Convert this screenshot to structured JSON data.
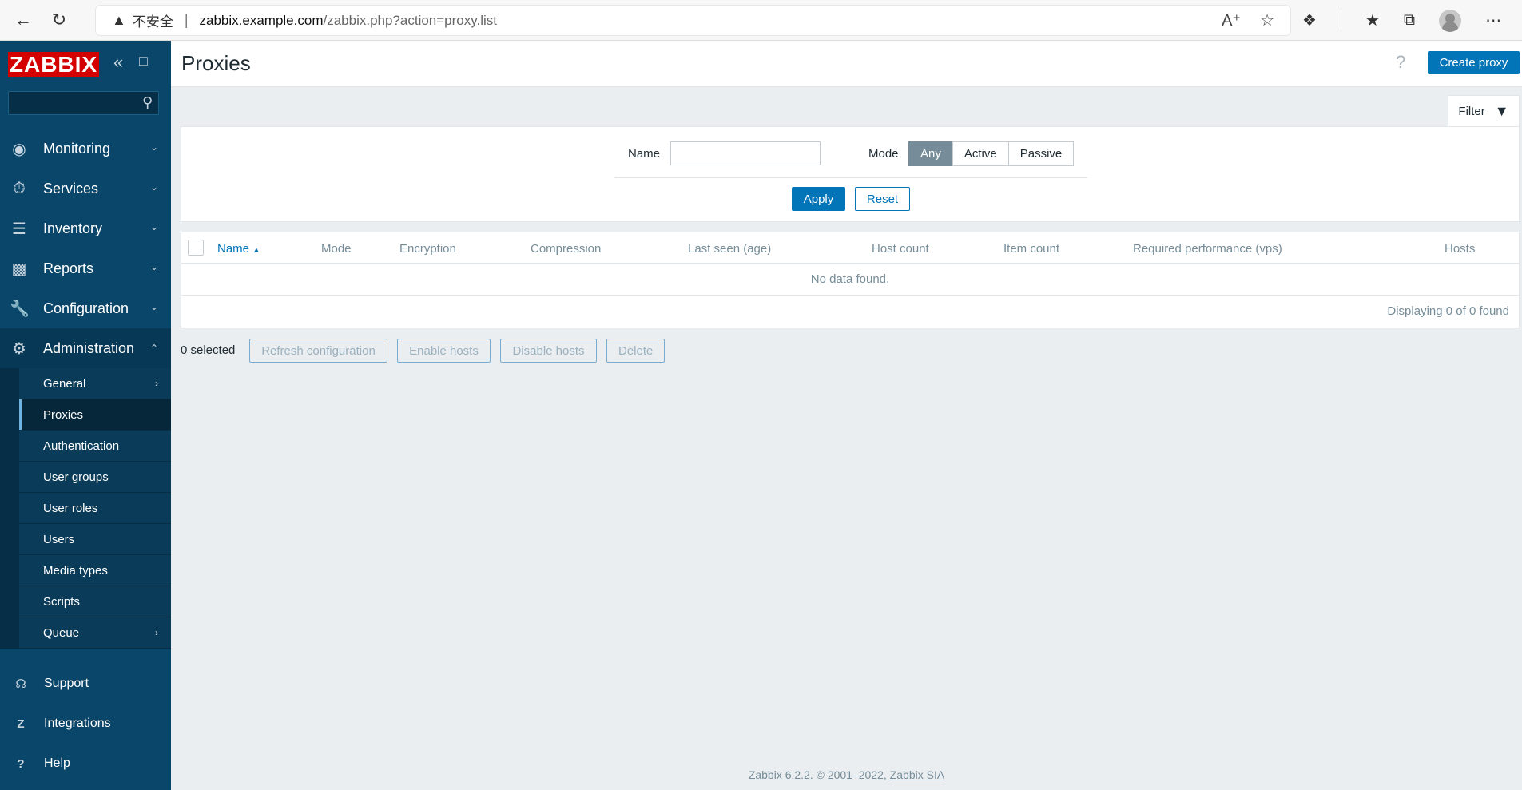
{
  "browser": {
    "insecure_label": "不安全",
    "url_host": "zabbix.example.com",
    "url_path": "/zabbix.php?action=proxy.list"
  },
  "sidebar": {
    "logo": "ZABBIX",
    "search_placeholder": "",
    "menu": [
      {
        "label": "Monitoring",
        "icon": "eye-icon"
      },
      {
        "label": "Services",
        "icon": "stopwatch-icon"
      },
      {
        "label": "Inventory",
        "icon": "list-icon"
      },
      {
        "label": "Reports",
        "icon": "bar-chart-icon"
      },
      {
        "label": "Configuration",
        "icon": "wrench-icon"
      },
      {
        "label": "Administration",
        "icon": "gear-icon"
      }
    ],
    "submenu": [
      {
        "label": "General"
      },
      {
        "label": "Proxies"
      },
      {
        "label": "Authentication"
      },
      {
        "label": "User groups"
      },
      {
        "label": "User roles"
      },
      {
        "label": "Users"
      },
      {
        "label": "Media types"
      },
      {
        "label": "Scripts"
      },
      {
        "label": "Queue"
      }
    ],
    "bottom": [
      {
        "label": "Support",
        "icon": "headset-icon"
      },
      {
        "label": "Integrations",
        "icon": "z-icon"
      },
      {
        "label": "Help",
        "icon": "question-icon"
      }
    ]
  },
  "header": {
    "title": "Proxies",
    "create_button": "Create proxy"
  },
  "filter": {
    "tab_label": "Filter",
    "name_label": "Name",
    "name_value": "",
    "mode_label": "Mode",
    "mode_options": [
      "Any",
      "Active",
      "Passive"
    ],
    "mode_selected": "Any",
    "apply": "Apply",
    "reset": "Reset"
  },
  "table": {
    "columns": [
      "Name",
      "Mode",
      "Encryption",
      "Compression",
      "Last seen (age)",
      "Host count",
      "Item count",
      "Required performance (vps)",
      "Hosts"
    ],
    "empty_text": "No data found.",
    "paging": "Displaying 0 of 0 found"
  },
  "actions": {
    "selected": "0 selected",
    "buttons": [
      "Refresh configuration",
      "Enable hosts",
      "Disable hosts",
      "Delete"
    ]
  },
  "footer": {
    "text": "Zabbix 6.2.2. © 2001–2022,",
    "link": "Zabbix SIA"
  },
  "colors": {
    "sidebar": "#0a466a",
    "accent": "#0275b8",
    "logo": "#d40000",
    "selected_mode": "#768d99"
  }
}
